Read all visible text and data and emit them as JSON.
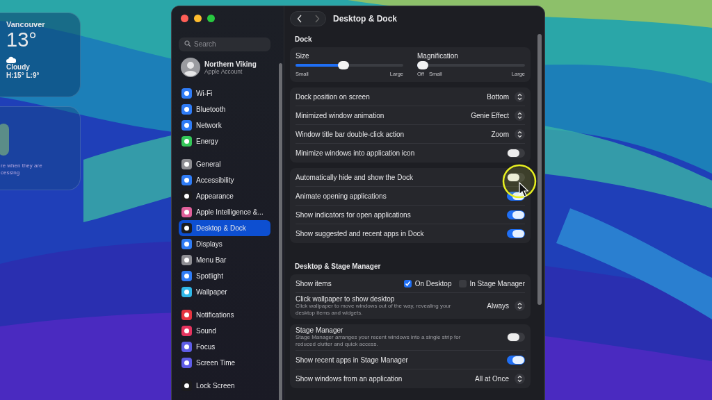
{
  "widgets": {
    "weather": {
      "city": "Vancouver",
      "temperature": "13°",
      "condition": "Cloudy",
      "range": "H:15° L:9°"
    },
    "second": {
      "lines": [
        "re when they are",
        "cessing"
      ]
    }
  },
  "window": {
    "title": "Desktop & Dock",
    "sidebar": {
      "search": {
        "placeholder": "Search"
      },
      "account": {
        "name": "Northern Viking",
        "subtitle": "Apple Account"
      },
      "groups": [
        [
          {
            "label": "Wi-Fi",
            "color": "#2f7cf6",
            "selected": false
          },
          {
            "label": "Bluetooth",
            "color": "#2f7cf6",
            "selected": false
          },
          {
            "label": "Network",
            "color": "#2f7cf6",
            "selected": false
          },
          {
            "label": "Energy",
            "color": "#34c759",
            "selected": false
          }
        ],
        [
          {
            "label": "General",
            "color": "#8e8e93",
            "selected": false
          },
          {
            "label": "Accessibility",
            "color": "#2f7cf6",
            "selected": false
          },
          {
            "label": "Appearance",
            "color": "#1c1c1e",
            "selected": false
          },
          {
            "label": "Apple Intelligence &...",
            "color": "#e0609a",
            "selected": false
          },
          {
            "label": "Desktop & Dock",
            "color": "#1c1c1e",
            "selected": true
          },
          {
            "label": "Displays",
            "color": "#2f7cf6",
            "selected": false
          },
          {
            "label": "Menu Bar",
            "color": "#8e8e93",
            "selected": false
          },
          {
            "label": "Spotlight",
            "color": "#2f7cf6",
            "selected": false
          },
          {
            "label": "Wallpaper",
            "color": "#30b8e8",
            "selected": false
          }
        ],
        [
          {
            "label": "Notifications",
            "color": "#e5343f",
            "selected": false
          },
          {
            "label": "Sound",
            "color": "#e5345f",
            "selected": false
          },
          {
            "label": "Focus",
            "color": "#5e5ce6",
            "selected": false
          },
          {
            "label": "Screen Time",
            "color": "#5e5ce6",
            "selected": false
          }
        ],
        [
          {
            "label": "Lock Screen",
            "color": "#1c1c1e",
            "selected": false
          }
        ]
      ]
    },
    "sections": [
      {
        "title": "Dock",
        "cards": [
          {
            "kind": "sliders",
            "sliders": [
              {
                "label": "Size",
                "level": 0.44,
                "scale_left": [
                  "Small"
                ],
                "scale_right": "Large"
              },
              {
                "label": "Magnification",
                "level": 0,
                "scale_left": [
                  "Off",
                  "Small"
                ],
                "scale_right": "Large"
              }
            ]
          },
          {
            "kind": "rows",
            "rows": [
              {
                "kind": "popup",
                "label": "Dock position on screen",
                "value": "Bottom"
              },
              {
                "kind": "popup",
                "label": "Minimized window animation",
                "value": "Genie Effect"
              },
              {
                "kind": "popup",
                "label": "Window title bar double-click action",
                "value": "Zoom"
              },
              {
                "kind": "toggle",
                "label": "Minimize windows into application icon",
                "on": false
              }
            ]
          },
          {
            "kind": "rows",
            "rows": [
              {
                "kind": "toggle",
                "label": "Automatically hide and show the Dock",
                "on": false
              },
              {
                "kind": "toggle",
                "label": "Animate opening applications",
                "on": true
              },
              {
                "kind": "toggle",
                "label": "Show indicators for open applications",
                "on": true
              },
              {
                "kind": "toggle",
                "label": "Show suggested and recent apps in Dock",
                "on": true
              }
            ]
          }
        ]
      },
      {
        "title": "Desktop & Stage Manager",
        "cards": [
          {
            "kind": "rows",
            "rows": [
              {
                "kind": "checks",
                "label": "Show items",
                "options": [
                  {
                    "label": "On Desktop",
                    "checked": true
                  },
                  {
                    "label": "In Stage Manager",
                    "checked": false
                  }
                ]
              },
              {
                "kind": "popup",
                "label": "Click wallpaper to show desktop",
                "value": "Always",
                "description": "Click wallpaper to move windows out of the way, revealing your desktop items and widgets."
              }
            ]
          },
          {
            "kind": "rows",
            "rows": [
              {
                "kind": "toggle",
                "label": "Stage Manager",
                "on": false,
                "description": "Stage Manager arranges your recent windows into a single strip for reduced clutter and quick access."
              },
              {
                "kind": "toggle",
                "label": "Show recent apps in Stage Manager",
                "on": true
              },
              {
                "kind": "popup",
                "label": "Show windows from an application",
                "value": "All at Once"
              }
            ]
          }
        ]
      }
    ]
  }
}
